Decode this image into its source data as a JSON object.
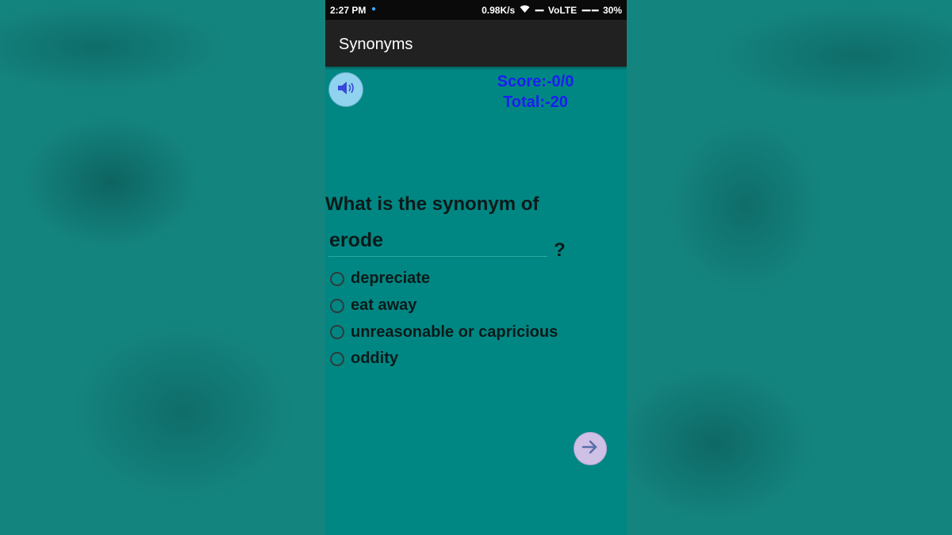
{
  "status_bar": {
    "time": "2:27 PM",
    "network_speed": "0.98K/s",
    "signal_text": "VoLTE",
    "battery": "30%"
  },
  "app": {
    "title": "Synonyms"
  },
  "score": {
    "score_text": "Score:-0/0",
    "total_text": "Total:-20"
  },
  "question": {
    "prompt": "What is the synonym  of",
    "word": "erode",
    "question_mark": "?"
  },
  "options": [
    {
      "label": "depreciate",
      "selected": false
    },
    {
      "label": "eat away",
      "selected": false
    },
    {
      "label": "unreasonable or capricious",
      "selected": false
    },
    {
      "label": "oddity",
      "selected": false
    }
  ],
  "icons": {
    "speaker": "speaker-icon",
    "next": "arrow-right-icon"
  },
  "colors": {
    "background": "#008783",
    "score_text": "#1d1df2",
    "appbar": "#212121",
    "speaker_button": "#8fd3ee",
    "next_button": "#cfc0e6"
  }
}
